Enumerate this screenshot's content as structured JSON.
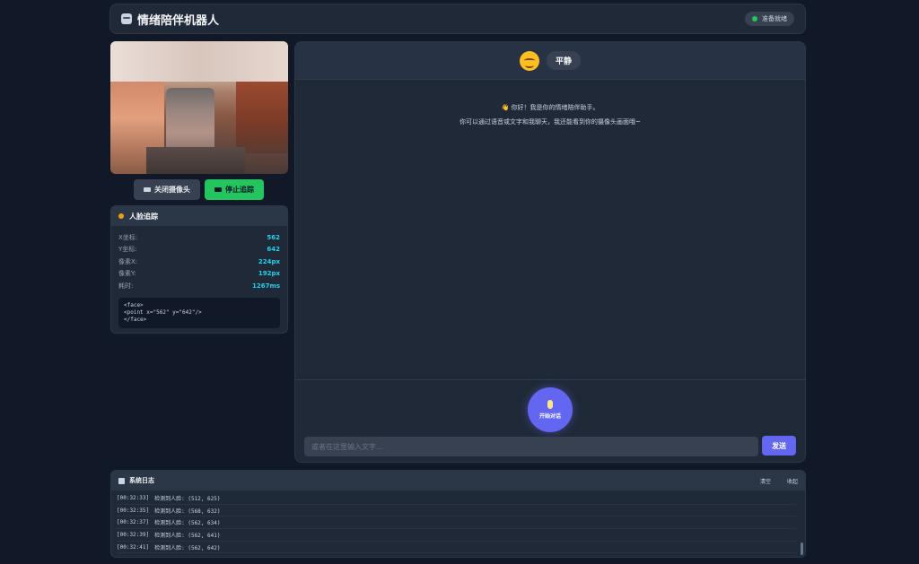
{
  "header": {
    "title": "情绪陪伴机器人",
    "status": "准备就绪"
  },
  "controls": {
    "close_camera": "关闭摄像头",
    "stop_tracking": "停止追踪"
  },
  "face_tracking": {
    "title": "人脸追踪",
    "stats": [
      {
        "label": "X坐标:",
        "value": "562"
      },
      {
        "label": "Y坐标:",
        "value": "642"
      },
      {
        "label": "像素X:",
        "value": "224px"
      },
      {
        "label": "像素Y:",
        "value": "192px"
      },
      {
        "label": "耗时:",
        "value": "1267ms"
      }
    ],
    "code": [
      "<face>",
      "<point x=\"562\" y=\"642\"/>",
      "</face>"
    ]
  },
  "chat": {
    "mood": "平静",
    "greeting_line1": "👋 你好！我是你的情绪陪伴助手。",
    "greeting_line2": "你可以通过语音或文字和我聊天，我还能看到你的摄像头画面哦~",
    "mic_label": "开始对话",
    "input_placeholder": "或者在这里输入文字...",
    "send_label": "发送"
  },
  "log": {
    "title": "系统日志",
    "clear_label": "清空",
    "collapse_label": "收起",
    "items": [
      {
        "time": "[00:32:33]",
        "text": "检测到人脸: (512, 625)"
      },
      {
        "time": "[00:32:35]",
        "text": "检测到人脸: (568, 632)"
      },
      {
        "time": "[00:32:37]",
        "text": "检测到人脸: (562, 634)"
      },
      {
        "time": "[00:32:39]",
        "text": "检测到人脸: (562, 641)"
      },
      {
        "time": "[00:32:41]",
        "text": "检测到人脸: (562, 642)"
      }
    ]
  },
  "colors": {
    "accent": "#6366f1",
    "success": "#22c55e",
    "value": "#22d3ee"
  }
}
